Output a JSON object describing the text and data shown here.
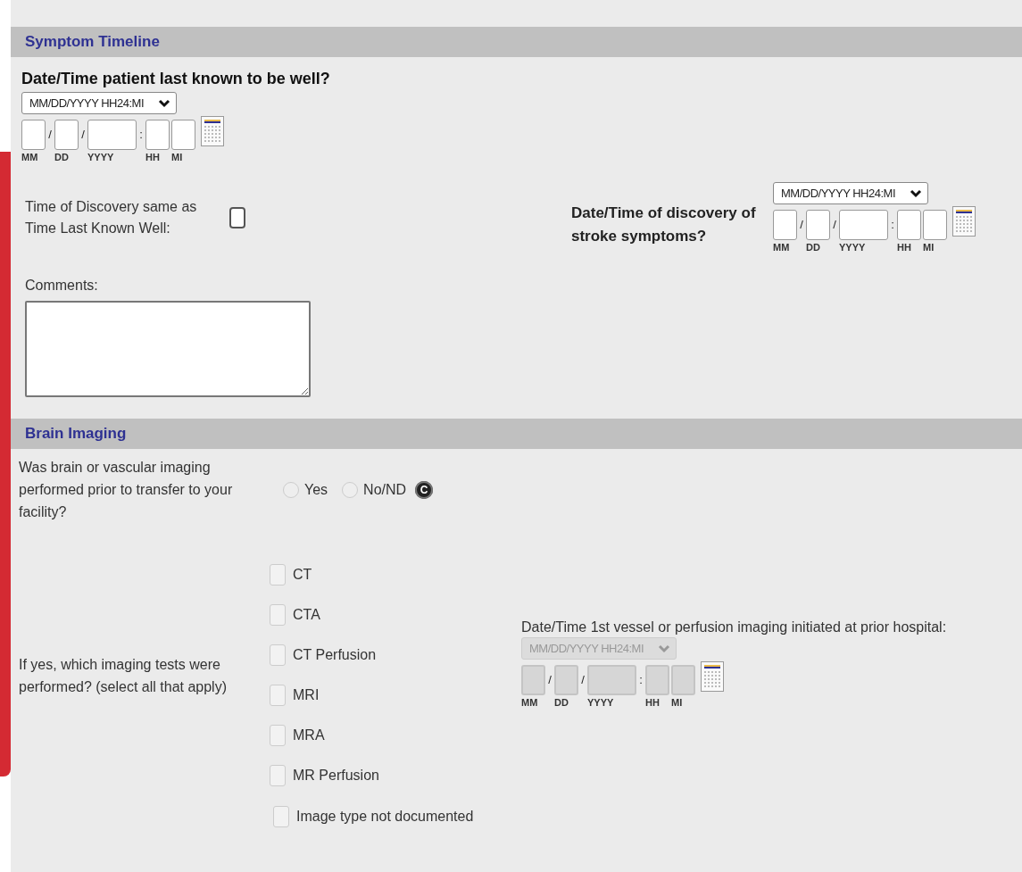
{
  "symptom_timeline": {
    "title": "Symptom Timeline",
    "last_known_well": {
      "label": "Date/Time patient last known to be well?",
      "format": "MM/DD/YYYY HH24:MI",
      "disabled": false,
      "separators": [
        "/",
        "/",
        ":"
      ],
      "parts": [
        "MM",
        "DD",
        "YYYY",
        "HH",
        "MI"
      ]
    },
    "same_as": {
      "label": "Time of Discovery same as Time Last Known Well:",
      "checked": false
    },
    "discovery": {
      "label": "Date/Time of discovery of stroke symptoms?",
      "format": "MM/DD/YYYY HH24:MI",
      "disabled": false,
      "separators": [
        "/",
        "/",
        ":"
      ],
      "parts": [
        "MM",
        "DD",
        "YYYY",
        "HH",
        "MI"
      ]
    },
    "comments": {
      "label": "Comments:"
    }
  },
  "brain_imaging": {
    "title": "Brain Imaging",
    "question": {
      "label": "Was brain or vascular imaging performed prior to transfer to your facility?",
      "options": [
        {
          "label": "Yes",
          "selected": false
        },
        {
          "label": "No/ND",
          "selected": false
        }
      ],
      "clear": "C"
    },
    "tests": {
      "label": "If yes, which imaging tests were performed? (select all that apply)",
      "items": [
        {
          "label": "CT",
          "checked": false
        },
        {
          "label": "CTA",
          "checked": false
        },
        {
          "label": "CT Perfusion",
          "checked": false
        },
        {
          "label": "MRI",
          "checked": false
        },
        {
          "label": "MRA",
          "checked": false
        },
        {
          "label": "MR Perfusion",
          "checked": false
        }
      ],
      "not_documented": {
        "label": "Image type not documented",
        "checked": false
      },
      "datetime": {
        "label": "Date/Time 1st vessel or perfusion imaging initiated at prior hospital:",
        "format": "MM/DD/YYYY HH24:MI",
        "disabled": true,
        "separators": [
          "/",
          "/",
          ":"
        ],
        "parts": [
          "MM",
          "DD",
          "YYYY",
          "HH",
          "MI"
        ]
      }
    }
  }
}
